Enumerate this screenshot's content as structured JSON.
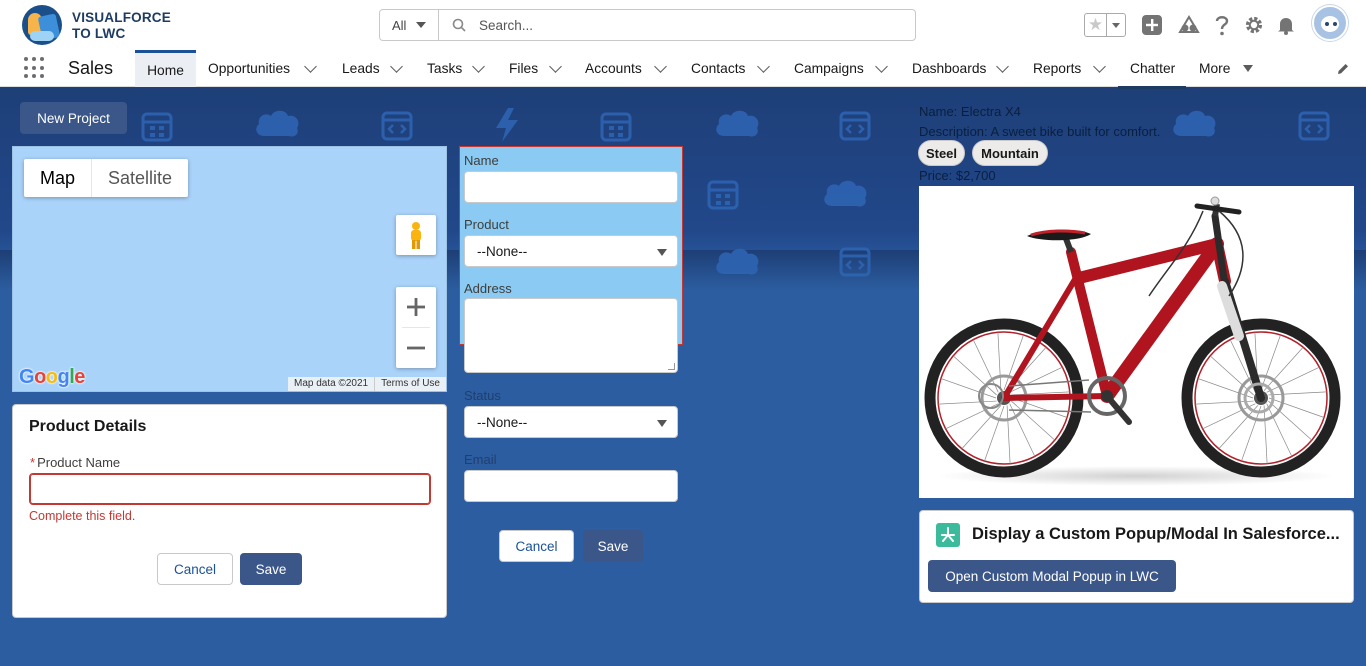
{
  "header": {
    "brand_line1": "VISUALFORCE",
    "brand_line2": "TO LWC",
    "search": {
      "scope": "All",
      "placeholder": "Search..."
    },
    "icons": [
      "favorites-star-icon",
      "add-icon",
      "trailhead-icon",
      "help-icon",
      "setup-gear-icon",
      "notifications-bell-icon",
      "user-avatar"
    ]
  },
  "nav": {
    "app_name": "Sales",
    "items": [
      {
        "label": "Home",
        "active": true
      },
      {
        "label": "Opportunities"
      },
      {
        "label": "Leads"
      },
      {
        "label": "Tasks"
      },
      {
        "label": "Files"
      },
      {
        "label": "Accounts"
      },
      {
        "label": "Contacts"
      },
      {
        "label": "Campaigns"
      },
      {
        "label": "Dashboards"
      },
      {
        "label": "Reports"
      },
      {
        "label": "Chatter"
      },
      {
        "label": "More"
      }
    ]
  },
  "new_project_label": "New Project",
  "map": {
    "type_map": "Map",
    "type_satellite": "Satellite",
    "logo": "Google",
    "data_credit": "Map data ©2021",
    "terms": "Terms of Use"
  },
  "product_details": {
    "title": "Product Details",
    "field_label": "Product Name",
    "required_marker": "*",
    "error": "Complete this field.",
    "cancel": "Cancel",
    "save": "Save"
  },
  "form": {
    "name_label": "Name",
    "product_label": "Product",
    "product_value": "--None--",
    "address_label": "Address",
    "status_label": "Status",
    "status_value": "--None--",
    "email_label": "Email",
    "cancel": "Cancel",
    "save": "Save"
  },
  "product": {
    "name_line": "Name: Electra X4",
    "description_line": "Description: A sweet bike built for comfort.",
    "tags": [
      "Steel",
      "Mountain"
    ],
    "price_line": "Price: $2,700"
  },
  "modal_card": {
    "title": "Display a Custom Popup/Modal In Salesforce...",
    "button": "Open Custom Modal Popup in LWC"
  },
  "colors": {
    "brand_button": "#3b5689",
    "page_background": "#2c5da0",
    "error_red": "#c23934",
    "map_water": "#aad3fa",
    "form_highlight": "#8bcaf3"
  }
}
